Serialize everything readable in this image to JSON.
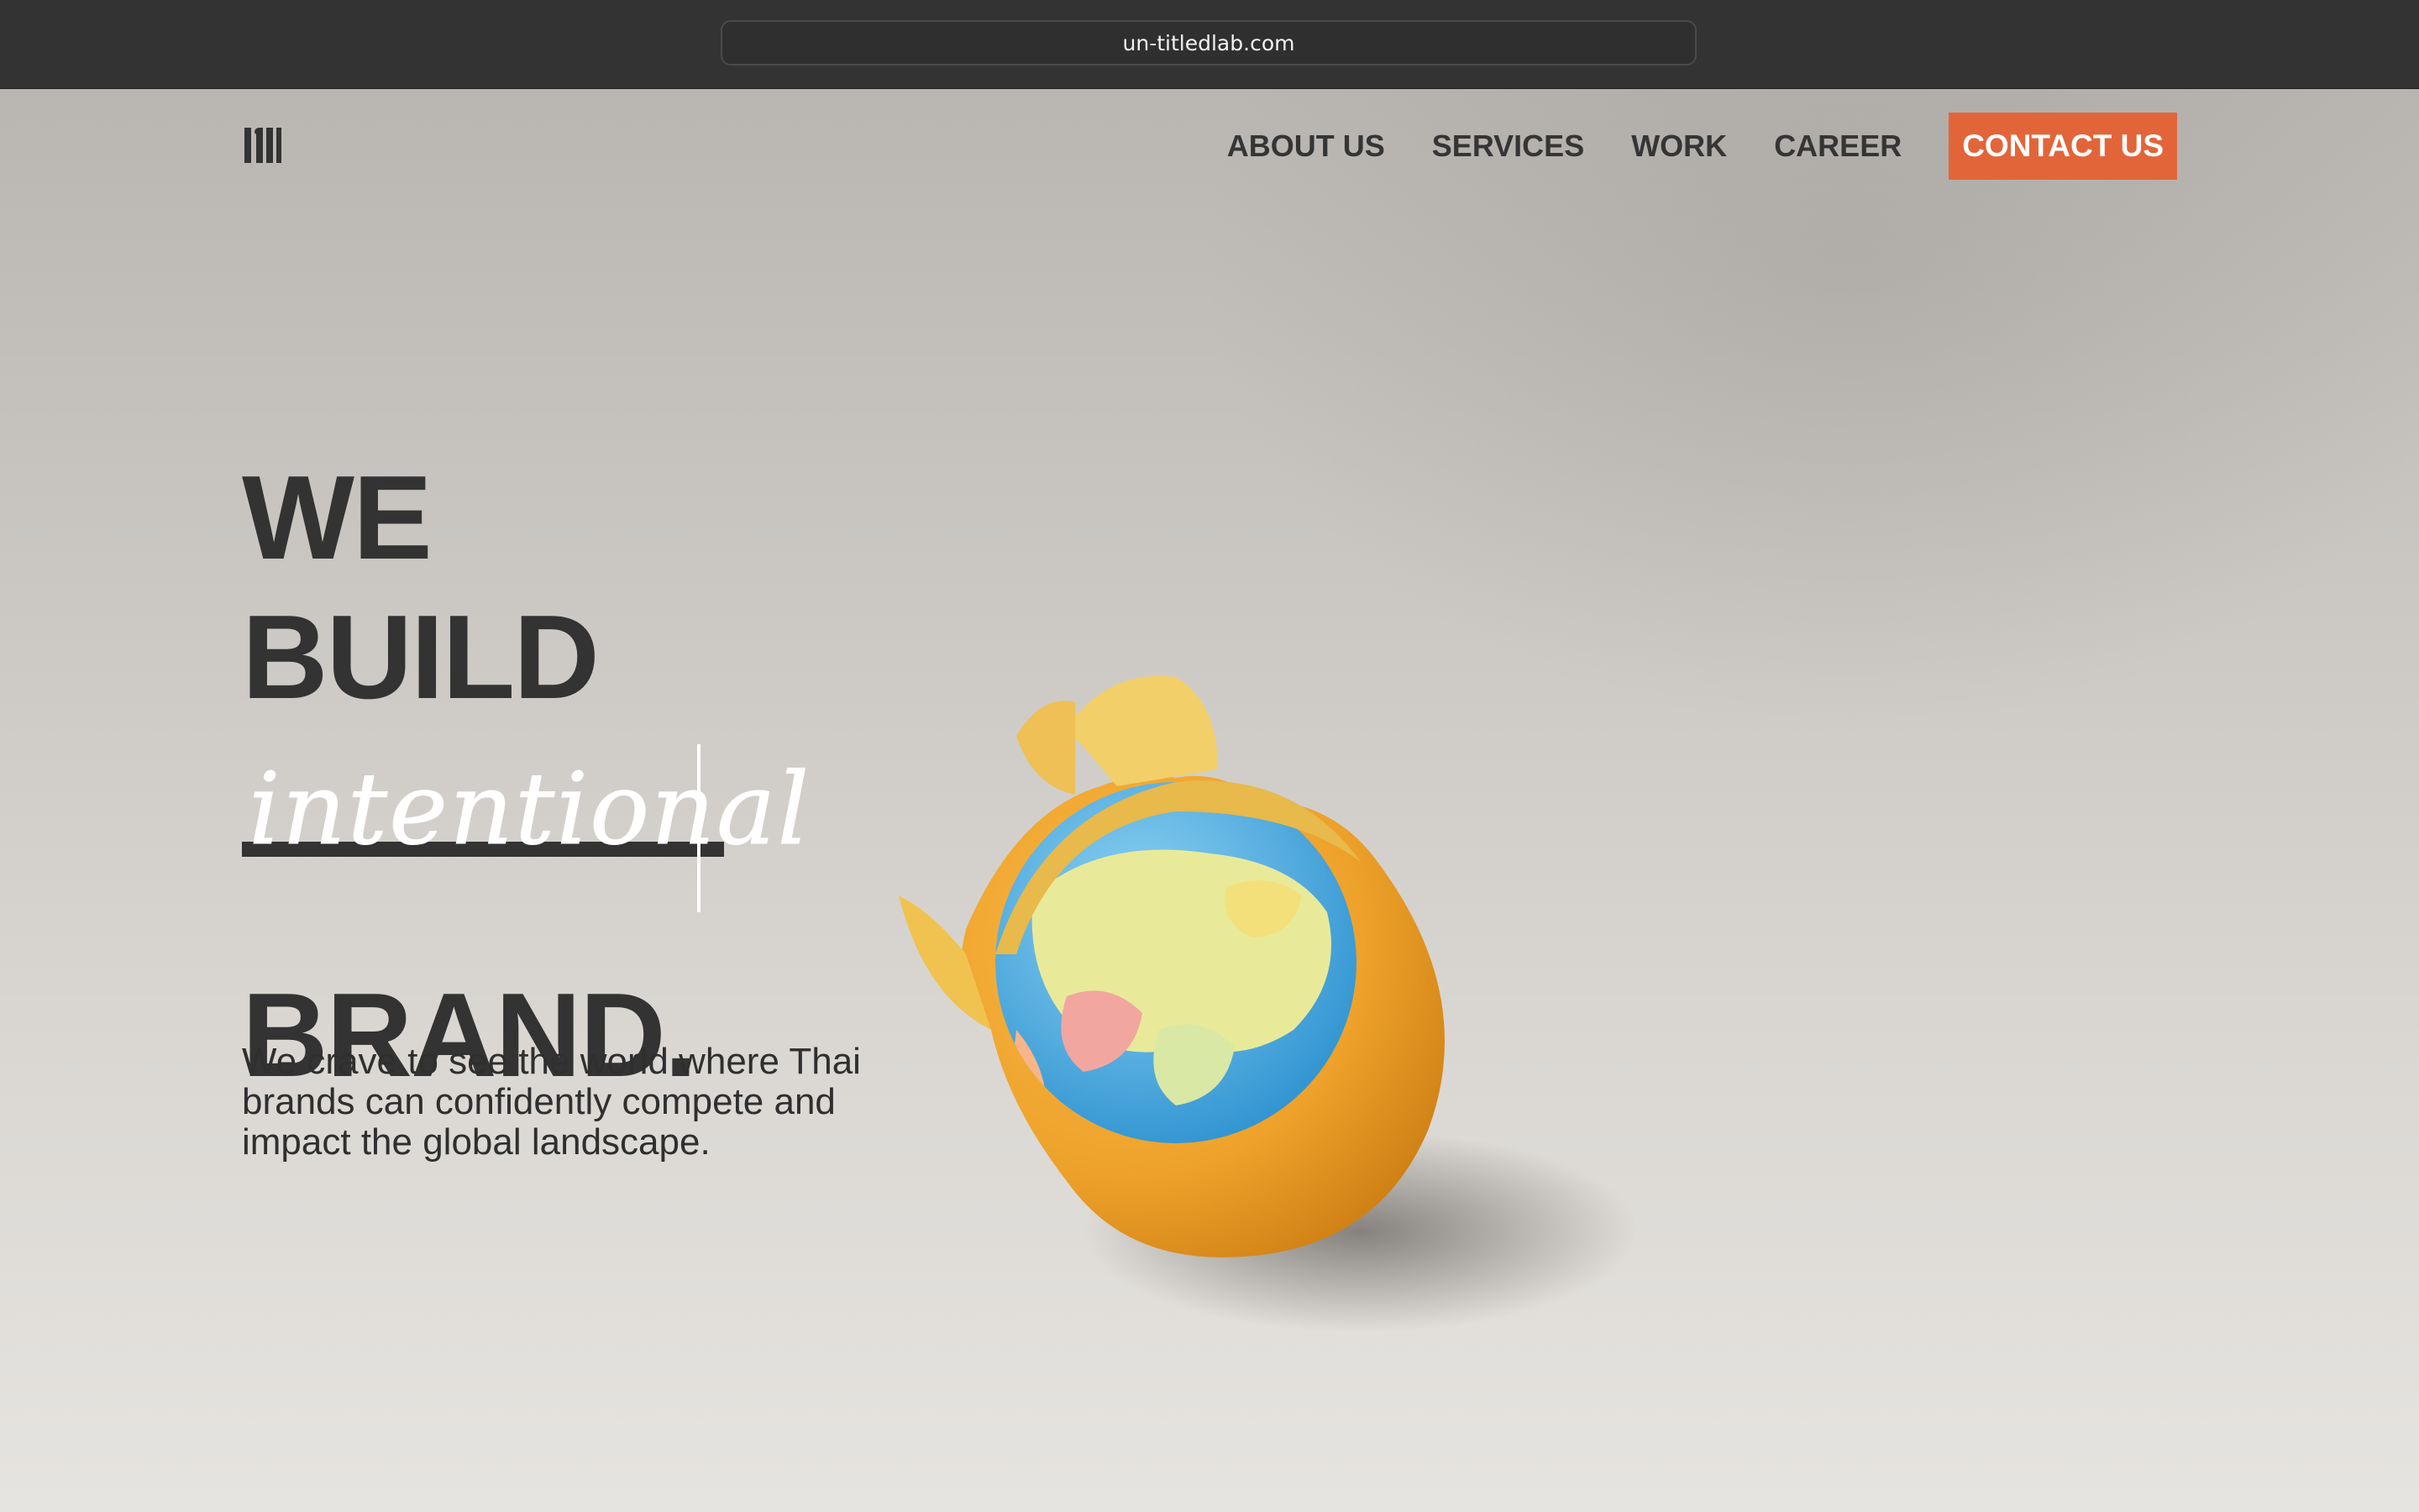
{
  "browser": {
    "url": "un-titledlab.com"
  },
  "header": {
    "logo_icon": "uni-monogram-logo",
    "nav": [
      "ABOUT US",
      "SERVICES",
      "WORK",
      "CAREER"
    ],
    "cta_label": "CONTACT US",
    "cta_color": "#e2653a"
  },
  "hero": {
    "line1": "WE",
    "line2": "BUILD",
    "script_word": "intentional",
    "line4": "BRAND.",
    "tagline": "We crave to see the world where Thai brands can confidently compete and impact the global landscape.",
    "image_icon": "orange-peel-globe-image"
  },
  "colors": {
    "text_dark": "#333333",
    "accent": "#e2653a"
  }
}
